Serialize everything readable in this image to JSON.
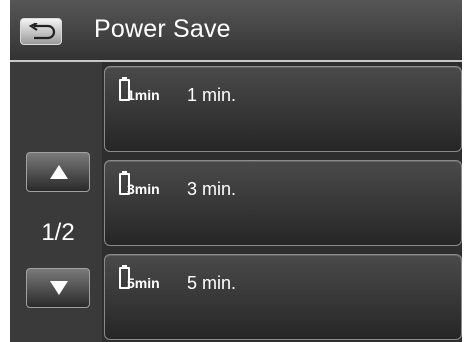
{
  "header": {
    "title": "Power Save",
    "back_icon": "back-arrow-icon"
  },
  "pager": {
    "indicator": "1/2",
    "up_icon": "triangle-up-icon",
    "down_icon": "triangle-down-icon"
  },
  "options": [
    {
      "icon_text": "1min",
      "label": "1 min.",
      "icon": "battery-timer-icon"
    },
    {
      "icon_text": "3min",
      "label": "3 min.",
      "icon": "battery-timer-icon"
    },
    {
      "icon_text": "5min",
      "label": "5 min.",
      "icon": "battery-timer-icon"
    }
  ],
  "colors": {
    "background": "#2e2e2e",
    "header": "#444444",
    "text": "#ffffff",
    "divider": "#c8c8c8"
  }
}
